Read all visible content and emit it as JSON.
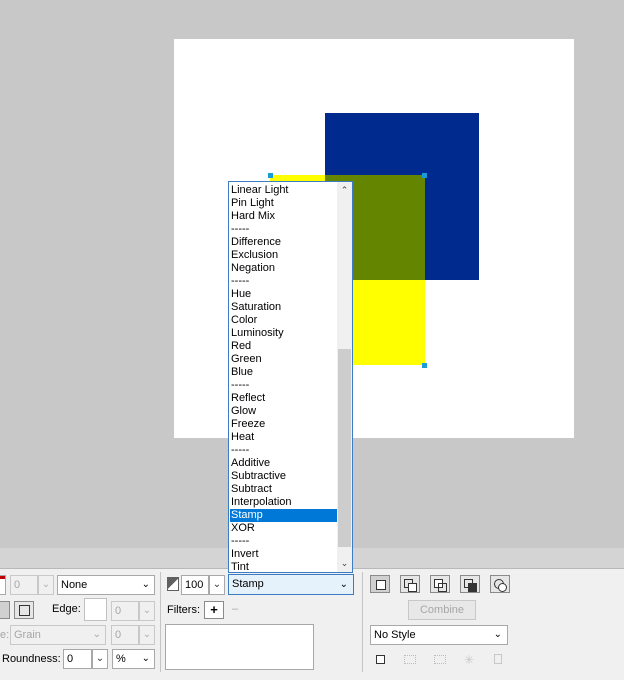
{
  "colors": {
    "blue": "#002a8e",
    "yellow": "#ffff00",
    "olive": "#638500",
    "selection": "#0078d7",
    "handle": "#1a9bd7"
  },
  "blend_list": {
    "items": [
      "Linear Light",
      "Pin Light",
      "Hard Mix",
      "-----",
      "Difference",
      "Exclusion",
      "Negation",
      "-----",
      "Hue",
      "Saturation",
      "Color",
      "Luminosity",
      "Red",
      "Green",
      "Blue",
      "-----",
      "Reflect",
      "Glow",
      "Freeze",
      "Heat",
      "-----",
      "Additive",
      "Subtractive",
      "Subtract",
      "Interpolation",
      "Stamp",
      "XOR",
      "-----",
      "Invert",
      "Tint"
    ],
    "selected": "Stamp",
    "scroll_up_icon": "chevron-up-icon",
    "scroll_down_icon": "chevron-down-icon"
  },
  "panel": {
    "width_value": "0",
    "line_style": "None",
    "edge_label": "Edge:",
    "edge_value": "0",
    "brush_value": "Grain",
    "brush_amount": "0",
    "roundness_label": "Roundness:",
    "roundness_value": "0",
    "roundness_unit": "%",
    "opacity_value": "100",
    "blend_value": "Stamp",
    "filters_label": "Filters:",
    "filters_add": "+",
    "filters_remove": "–",
    "combine_label": "Combine",
    "style_value": "No Style"
  }
}
